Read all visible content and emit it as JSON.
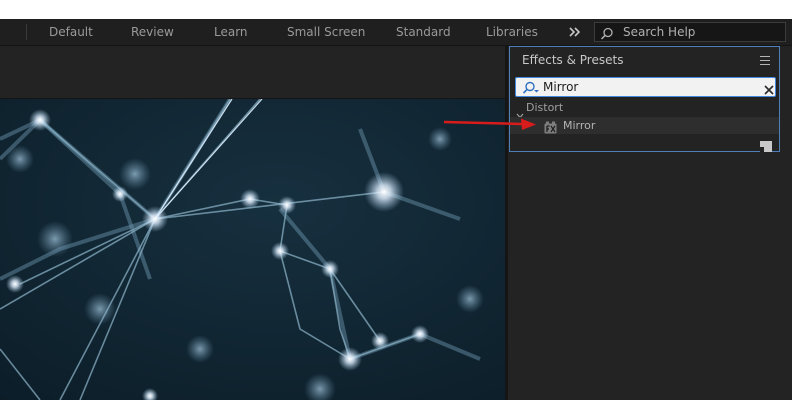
{
  "workspace_bar": {
    "tabs": [
      "Default",
      "Review",
      "Learn",
      "Small Screen",
      "Standard",
      "Libraries"
    ],
    "overflow_icon": "double-chevron-right-icon",
    "search_help_label": "Search Help"
  },
  "effects_panel": {
    "title": "Effects & Presets",
    "search_value": "Mirror",
    "category": "Distort",
    "effect": "Mirror"
  },
  "colors": {
    "panel_focus_border": "#4e7fb8",
    "annotation_arrow": "#d81b1b"
  }
}
